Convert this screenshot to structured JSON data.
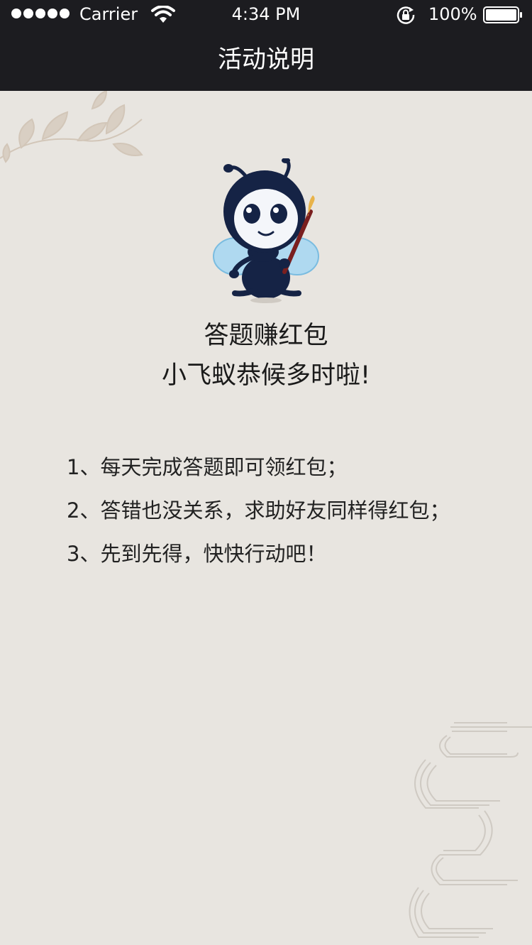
{
  "status_bar": {
    "carrier": "Carrier",
    "time": "4:34 PM",
    "battery_percent": "100%",
    "signal_bars": 5,
    "battery_level": 1.0
  },
  "nav": {
    "title": "活动说明"
  },
  "hero": {
    "line1": "答题赚红包",
    "line2": "小飞蚁恭候多时啦!"
  },
  "rules": [
    "1、每天完成答题即可领红包；",
    "2、答错也没关系，求助好友同样得红包；",
    "3、先到先得，快快行动吧！"
  ],
  "colors": {
    "bar_background": "#1c1c20",
    "page_background": "#e8e5e0",
    "text": "#222222",
    "mascot_body": "#152345",
    "wing": "#a9d8f2"
  },
  "icons": {
    "wifi": "wifi-icon",
    "rotation_lock": "rotation-lock-icon",
    "battery": "battery-icon",
    "mascot": "ant-mascot"
  }
}
